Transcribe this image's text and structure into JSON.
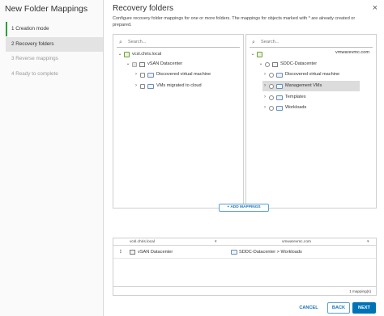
{
  "wizard": {
    "title": "New Folder Mappings",
    "steps": [
      {
        "label": "1  Creation mode",
        "state": "done"
      },
      {
        "label": "2  Recovery folders",
        "state": "current"
      },
      {
        "label": "3  Reverse mappings",
        "state": "disabled"
      },
      {
        "label": "4  Ready to complete",
        "state": "disabled"
      }
    ]
  },
  "page": {
    "title": "Recovery folders",
    "description": "Configure recovery folder mappings for one or more folders. The mappings for objects marked with * are already created or prepared.",
    "close_glyph": "×"
  },
  "left_panel": {
    "search_placeholder": "Search...",
    "tree": [
      {
        "label": "vcsl.chris.local"
      },
      {
        "label": "vSAN Datacenter"
      },
      {
        "label": "Discovered virtual machine"
      },
      {
        "label": "VMs migrated to cloud"
      }
    ]
  },
  "right_panel": {
    "search_placeholder": "Search...",
    "header": "vmwarevmc.com",
    "tree": [
      {
        "label": "SDDC-Datacenter"
      },
      {
        "label": "Discovered virtual machine"
      },
      {
        "label": "Management VMs"
      },
      {
        "label": "Templates"
      },
      {
        "label": "Workloads"
      }
    ]
  },
  "add_mappings_label": "+ ADD MAPPINGS",
  "grid": {
    "columns": [
      "vcsl.chris.local",
      "vmwarevmc.com"
    ],
    "rows": [
      {
        "source": "vSAN Datacenter",
        "target": "SDDC-Datacenter > Workloads"
      }
    ],
    "footer": "1 mapping(s)"
  },
  "footer_buttons": {
    "cancel": "CANCEL",
    "back": "BACK",
    "next": "NEXT"
  },
  "colors": {
    "accent": "#0073b6",
    "step_done": "#2e9e3d"
  }
}
